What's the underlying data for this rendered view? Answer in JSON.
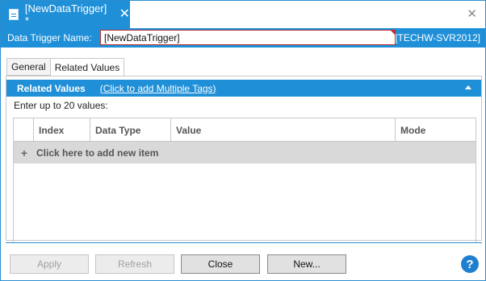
{
  "document_tab": {
    "title": "[NewDataTrigger] *",
    "close_glyph": "✕",
    "icon": "document-icon"
  },
  "window": {
    "close_glyph": "✕"
  },
  "name_bar": {
    "label": "Data Trigger Name:",
    "value": "[NewDataTrigger]",
    "server": "[TECHW-SVR2012]"
  },
  "tabs": [
    {
      "label": "General",
      "active": false
    },
    {
      "label": "Related Values",
      "active": true
    }
  ],
  "section": {
    "title": "Related Values",
    "link": "(Click to add Multiple Tags)",
    "hint": "Enter up to 20 values:"
  },
  "grid": {
    "columns": [
      "Index",
      "Data Type",
      "Value",
      "Mode"
    ],
    "add_row_glyph": "+",
    "add_row_label": "Click here to add new item"
  },
  "buttons": {
    "apply": "Apply",
    "refresh": "Refresh",
    "close": "Close",
    "new": "New...",
    "help": "?"
  },
  "colors": {
    "accent": "#1f8fd8",
    "required_border": "#c03030",
    "add_row_bg": "#d9d9d9"
  }
}
